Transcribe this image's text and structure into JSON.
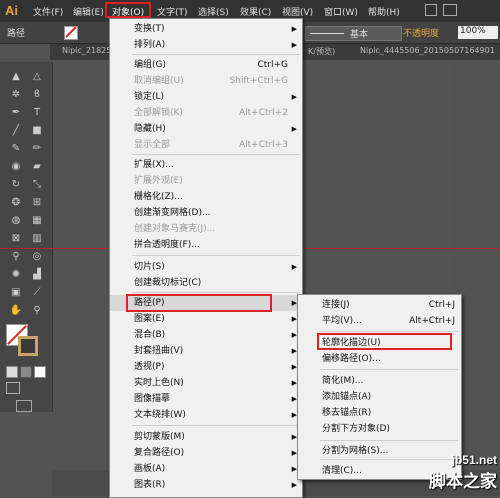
{
  "app": {
    "logo": "Ai"
  },
  "menubar": {
    "items": [
      "文件(F)",
      "编辑(E)",
      "对象(O)",
      "文字(T)",
      "选择(S)",
      "效果(C)",
      "视图(V)",
      "窗口(W)",
      "帮助(H)"
    ]
  },
  "control_bar": {
    "label": "路径",
    "stroke_style": "基本",
    "opacity_label": "不透明度",
    "opacity_value": "100%"
  },
  "doc_tabs": [
    "Nipic_21825",
    "K/预览)",
    "Nipic_4445506_20150507164901"
  ],
  "object_menu": {
    "items": [
      {
        "label": "变换(T)",
        "shortcut": "",
        "submenu": true,
        "disabled": false
      },
      {
        "label": "排列(A)",
        "shortcut": "",
        "submenu": true,
        "disabled": false
      },
      {
        "label": "编组(G)",
        "shortcut": "Ctrl+G",
        "submenu": false,
        "disabled": false
      },
      {
        "label": "取消编组(U)",
        "shortcut": "Shift+Ctrl+G",
        "submenu": false,
        "disabled": true
      },
      {
        "label": "锁定(L)",
        "shortcut": "",
        "submenu": true,
        "disabled": false
      },
      {
        "label": "全部解锁(K)",
        "shortcut": "Alt+Ctrl+2",
        "submenu": false,
        "disabled": true
      },
      {
        "label": "隐藏(H)",
        "shortcut": "",
        "submenu": true,
        "disabled": false
      },
      {
        "label": "显示全部",
        "shortcut": "Alt+Ctrl+3",
        "submenu": false,
        "disabled": true
      },
      {
        "label": "扩展(X)...",
        "shortcut": "",
        "submenu": false,
        "disabled": false
      },
      {
        "label": "扩展外观(E)",
        "shortcut": "",
        "submenu": false,
        "disabled": true
      },
      {
        "label": "栅格化(Z)...",
        "shortcut": "",
        "submenu": false,
        "disabled": false
      },
      {
        "label": "创建渐变网格(D)...",
        "shortcut": "",
        "submenu": false,
        "disabled": false
      },
      {
        "label": "创建对象马赛克(J)...",
        "shortcut": "",
        "submenu": false,
        "disabled": true
      },
      {
        "label": "拼合透明度(F)...",
        "shortcut": "",
        "submenu": false,
        "disabled": false
      },
      {
        "label": "切片(S)",
        "shortcut": "",
        "submenu": true,
        "disabled": false
      },
      {
        "label": "创建裁切标记(C)",
        "shortcut": "",
        "submenu": false,
        "disabled": false
      },
      {
        "label": "路径(P)",
        "shortcut": "",
        "submenu": true,
        "disabled": false
      },
      {
        "label": "图案(E)",
        "shortcut": "",
        "submenu": true,
        "disabled": false
      },
      {
        "label": "混合(B)",
        "shortcut": "",
        "submenu": true,
        "disabled": false
      },
      {
        "label": "封套扭曲(V)",
        "shortcut": "",
        "submenu": true,
        "disabled": false
      },
      {
        "label": "透视(P)",
        "shortcut": "",
        "submenu": true,
        "disabled": false
      },
      {
        "label": "实时上色(N)",
        "shortcut": "",
        "submenu": true,
        "disabled": false
      },
      {
        "label": "图像描摹",
        "shortcut": "",
        "submenu": true,
        "disabled": false
      },
      {
        "label": "文本绕排(W)",
        "shortcut": "",
        "submenu": true,
        "disabled": false
      },
      {
        "label": "剪切蒙版(M)",
        "shortcut": "",
        "submenu": true,
        "disabled": false
      },
      {
        "label": "复合路径(O)",
        "shortcut": "",
        "submenu": true,
        "disabled": false
      },
      {
        "label": "画板(A)",
        "shortcut": "",
        "submenu": true,
        "disabled": false
      },
      {
        "label": "图表(R)",
        "shortcut": "",
        "submenu": true,
        "disabled": false
      }
    ]
  },
  "path_submenu": {
    "items": [
      {
        "label": "连接(J)",
        "shortcut": "Ctrl+J",
        "submenu": false
      },
      {
        "label": "平均(V)...",
        "shortcut": "Alt+Ctrl+J",
        "submenu": false
      },
      {
        "label": "轮廓化描边(U)",
        "shortcut": "",
        "submenu": false
      },
      {
        "label": "偏移路径(O)...",
        "shortcut": "",
        "submenu": false
      },
      {
        "label": "简化(M)...",
        "shortcut": "",
        "submenu": false
      },
      {
        "label": "添加锚点(A)",
        "shortcut": "",
        "submenu": false
      },
      {
        "label": "移去锚点(R)",
        "shortcut": "",
        "submenu": false
      },
      {
        "label": "分割下方对象(D)",
        "shortcut": "",
        "submenu": false
      },
      {
        "label": "分割为网格(S)...",
        "shortcut": "",
        "submenu": false
      },
      {
        "label": "清理(C)...",
        "shortcut": "",
        "submenu": false
      }
    ]
  },
  "watermark": {
    "url": "jb51.net",
    "name": "脚本之家"
  },
  "tool_icons": [
    "selection-icon",
    "direct-selection-icon",
    "magic-wand-icon",
    "lasso-icon",
    "pen-icon",
    "type-icon",
    "line-icon",
    "rectangle-icon",
    "paintbrush-icon",
    "pencil-icon",
    "blob-brush-icon",
    "eraser-icon",
    "rotate-icon",
    "scale-icon",
    "warp-icon",
    "free-transform-icon",
    "shape-builder-icon",
    "perspective-grid-icon",
    "mesh-icon",
    "gradient-icon",
    "eyedropper-icon",
    "blend-icon",
    "symbol-sprayer-icon",
    "column-graph-icon",
    "artboard-icon",
    "slice-icon",
    "hand-icon",
    "zoom-icon"
  ]
}
